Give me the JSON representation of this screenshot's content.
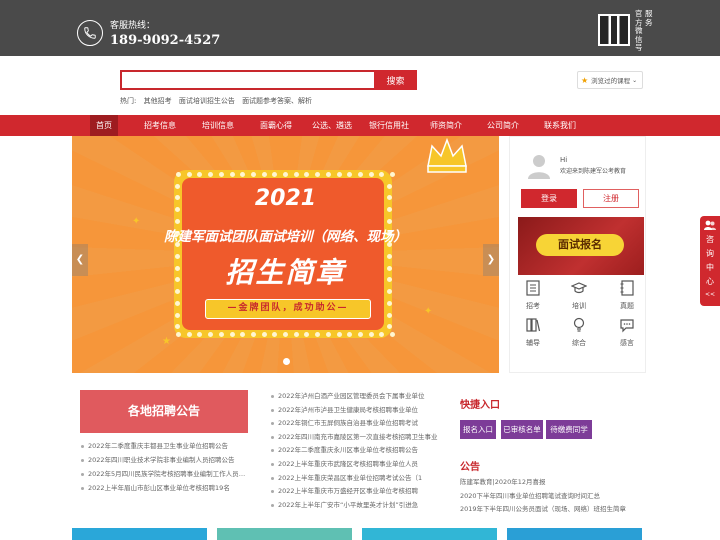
{
  "header": {
    "hotline_label": "客服热线：",
    "hotline_number": "189-9092-4527",
    "wechat_label_col1": "官方微信号",
    "wechat_label_col2": "服务"
  },
  "search": {
    "button_label": "搜索",
    "placeholder": "",
    "hot_label": "热门:",
    "hot_links": [
      "其他招考",
      "面试培训招生公告",
      "面试题参考答案、解析"
    ]
  },
  "recent_courses": {
    "label": "浏览过的课程"
  },
  "nav": {
    "items": [
      "首页",
      "招考信息",
      "培训信息",
      "面霸心得",
      "公选、遴选",
      "银行信用社",
      "师资简介",
      "公司简介",
      "联系我们"
    ],
    "active_index": 0
  },
  "banner": {
    "year": "2021",
    "line2": "陈建军面试团队面试培训（网络、现场）",
    "line3": "招生简章",
    "ribbon": "—金牌团队，成功助公—"
  },
  "user_panel": {
    "greeting": "Hi",
    "welcome": "欢迎来到陈建军公考教育",
    "login_label": "登录",
    "register_label": "注册",
    "signup_banner_label": "面试报名",
    "quick_links": [
      {
        "label": "招考",
        "icon": "document-list-icon"
      },
      {
        "label": "培训",
        "icon": "graduation-cap-icon"
      },
      {
        "label": "真题",
        "icon": "notebook-icon"
      },
      {
        "label": "辅导",
        "icon": "books-icon"
      },
      {
        "label": "综合",
        "icon": "lightbulb-icon"
      },
      {
        "label": "感言",
        "icon": "chat-bubble-icon"
      }
    ]
  },
  "recruitment": {
    "title": "各地招聘公告",
    "items": [
      "2022年二季度重庆丰都县卫生事业单位招聘公告",
      "2022年四川职业技术学院非事业编制人员招聘公告",
      "2022年5月四川民族学院考核招聘事业编制工作人员公告",
      "2022上半年眉山市彭山区事业单位考核招聘19名"
    ]
  },
  "news_list": [
    "2022年泸州白酒产业园区管理委员会下属事业单位",
    "2022年泸州市泸县卫生健康局考核招聘事业单位",
    "2022年铜仁市玉屏侗族自治县事业单位招聘考试",
    "2022年四川南充市嘉陵区第一次直接考核招聘卫生事业",
    "2022年二季度重庆永川区事业单位考核招聘公告",
    "2022上半年重庆市武隆区考核招聘事业单位人员",
    "2022上半年重庆荣昌区事业单位招聘考试公告（1",
    "2022上半年重庆市万盛经开区事业单位考核招聘",
    "2022年上半年广安市“小平故里英才计划”引进急"
  ],
  "quick_entry": {
    "title": "快捷入口",
    "buttons": [
      "报名入口",
      "已审核名单",
      "待缴费同学"
    ]
  },
  "notice": {
    "title": "公告",
    "items": [
      "陈建军教育|2020年12月喜报",
      "2020下半年四川事业单位招聘笔试查询时间汇总",
      "2019年下半年四川公务员面试（现场、网络）班招生简章"
    ]
  },
  "consult_tab": {
    "label": "咨询中心",
    "arrow": "<<"
  },
  "colors": {
    "brand_red": "#d0282e",
    "nav_active": "#9e1c20",
    "topbar": "#4a4a4a",
    "quick_btn_purple": "#7d3c98"
  }
}
